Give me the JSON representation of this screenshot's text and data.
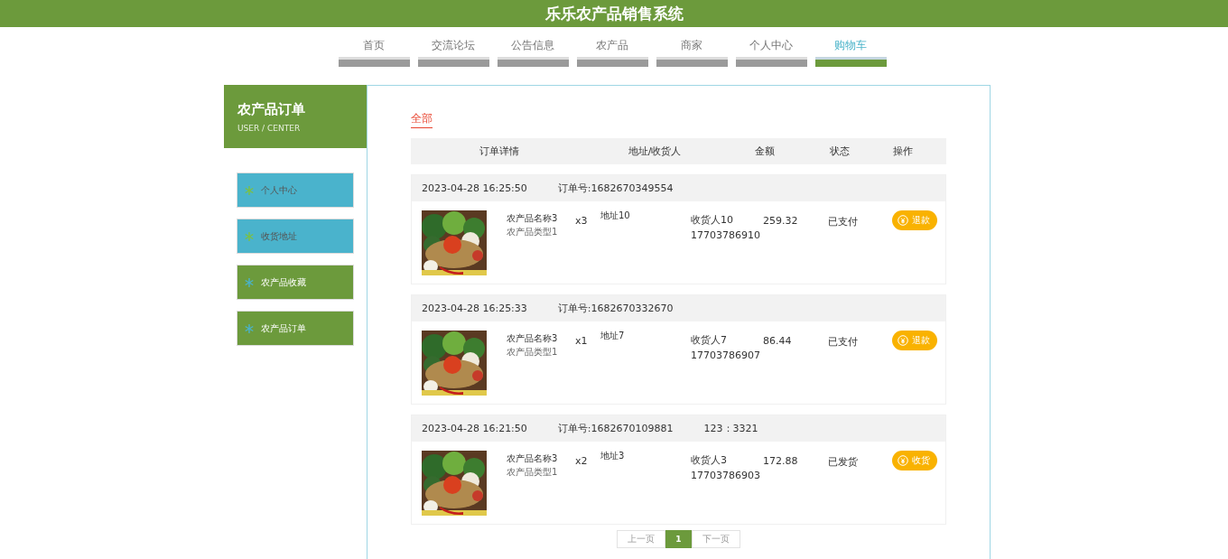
{
  "site_title": "乐乐农产品销售系统",
  "nav": [
    {
      "label": "首页",
      "selected": false
    },
    {
      "label": "交流论坛",
      "selected": false
    },
    {
      "label": "公告信息",
      "selected": false
    },
    {
      "label": "农产品",
      "selected": false
    },
    {
      "label": "商家",
      "selected": false
    },
    {
      "label": "个人中心",
      "selected": false
    },
    {
      "label": "购物车",
      "selected": true
    }
  ],
  "sidebar": {
    "title": "农产品订单",
    "subtitle": "USER / CENTER",
    "items": [
      {
        "label": "个人中心",
        "kind": "light"
      },
      {
        "label": "收货地址",
        "kind": "light"
      },
      {
        "label": "农产品收藏",
        "kind": "dark"
      },
      {
        "label": "农产品订单",
        "kind": "dark"
      }
    ]
  },
  "filter_tabs": [
    {
      "label": "全部",
      "selected": true
    }
  ],
  "columns": [
    "订单详情",
    "地址/收货人",
    "金额",
    "状态",
    "操作"
  ],
  "orders": [
    {
      "time": "2023-04-28 16:25:50",
      "order_no": "订单号:1682670349554",
      "product": "农产品名称3",
      "category": "农产品类型1",
      "quantity": "x3",
      "address": "地址10",
      "receiver": "收货人10",
      "phone": "17703786910",
      "amount": "259.32",
      "status": "已支付",
      "action": "退款"
    },
    {
      "time": "2023-04-28 16:25:33",
      "order_no": "订单号:1682670332670",
      "product": "农产品名称3",
      "category": "农产品类型1",
      "quantity": "x1",
      "address": "地址7",
      "receiver": "收货人7",
      "phone": "17703786907",
      "amount": "86.44",
      "status": "已支付",
      "action": "退款"
    },
    {
      "time": "2023-04-28 16:21:50",
      "order_no": "订单号:1682670109881",
      "note": "123：3321",
      "product": "农产品名称3",
      "category": "农产品类型1",
      "quantity": "x2",
      "address": "地址3",
      "receiver": "收货人3",
      "phone": "17703786903",
      "amount": "172.88",
      "status": "已发货",
      "action": "收货"
    }
  ],
  "pagination": {
    "prev": "上一页",
    "pages": [
      {
        "label": "1",
        "selected": true
      }
    ],
    "next": "下一页"
  }
}
